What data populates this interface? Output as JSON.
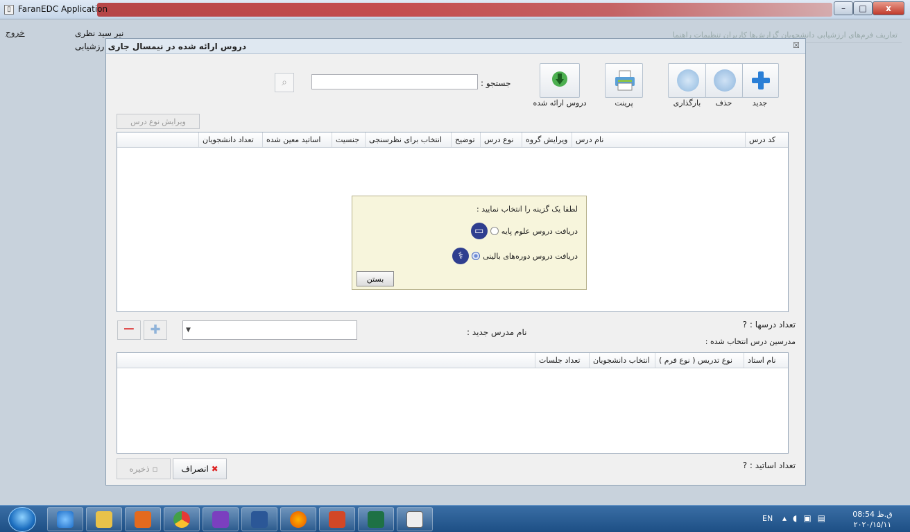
{
  "window": {
    "title": "FaranEDC Application",
    "app_icon": "app-icon",
    "controls": {
      "minimize": "–",
      "maximize": "□",
      "close": "x"
    }
  },
  "appbar": {
    "exit": "خروج",
    "user_line1": "نیر سید نظری",
    "user_line2": "رزشیابی",
    "menu_faded": "تعاریف   فرم‌های ارزشیابی   دانشجویان   گزارش‌ها   کاربران   تنظیمات   راهنما"
  },
  "dialog": {
    "title": "دروس ارائه شده در نیمسال جاری",
    "close": "☒",
    "toolbar": {
      "new": "جدید",
      "delete": "حذف",
      "reload": "بارگذاری",
      "print": "پرینت",
      "offered": "دروس ارائه شده"
    },
    "search": {
      "label": "جستجو :",
      "value": "",
      "button_icon": "search-icon"
    },
    "edit_type_button": "ویرایش نوع درس",
    "courses_columns": [
      "کد درس",
      "نام درس",
      "ویرایش گروه",
      "نوع درس",
      "توضیح",
      "انتخاب برای نظرسنجی",
      "جنسیت",
      "اساتید معین شده",
      "تعداد دانشجویان"
    ],
    "popup": {
      "title": "لطفا یک گزینه را انتخاب نمایید :",
      "option_basic": "دریافت دروس علوم پایه",
      "option_clinical": "دریافت دروس دوره‌های بالینی",
      "selected": "option_clinical",
      "close": "بستن"
    },
    "count_courses": "تعداد درسها :   ?",
    "teacher_label": "مدرسین درس انتخاب شده :",
    "new_teacher_label": "نام مدرس جدید :",
    "teacher_combo_value": "",
    "teachers_columns": [
      "نام استاد",
      "نوع تدریس ( نوع فرم )",
      "انتخاب دانشجویان",
      "تعداد جلسات"
    ],
    "count_teachers": "تعداد اساتید :   ?",
    "cancel": "انصراف",
    "save": "ذخیره"
  },
  "taskbar": {
    "apps": [
      "ie-icon",
      "explorer-icon",
      "media-icon",
      "chrome-icon",
      "visual-studio-icon",
      "word-icon",
      "firefox-icon",
      "powerpoint-icon",
      "excel-icon",
      "faranedc-icon"
    ],
    "lang": "EN",
    "time": "08:54 ق.ظ",
    "date": "۲۰۲۰/۱۵/۱۱"
  },
  "colors": {
    "accent": "#1f6fc9",
    "titlebar_band": "#b12a2a",
    "popup_bg": "#f7f5dc"
  }
}
